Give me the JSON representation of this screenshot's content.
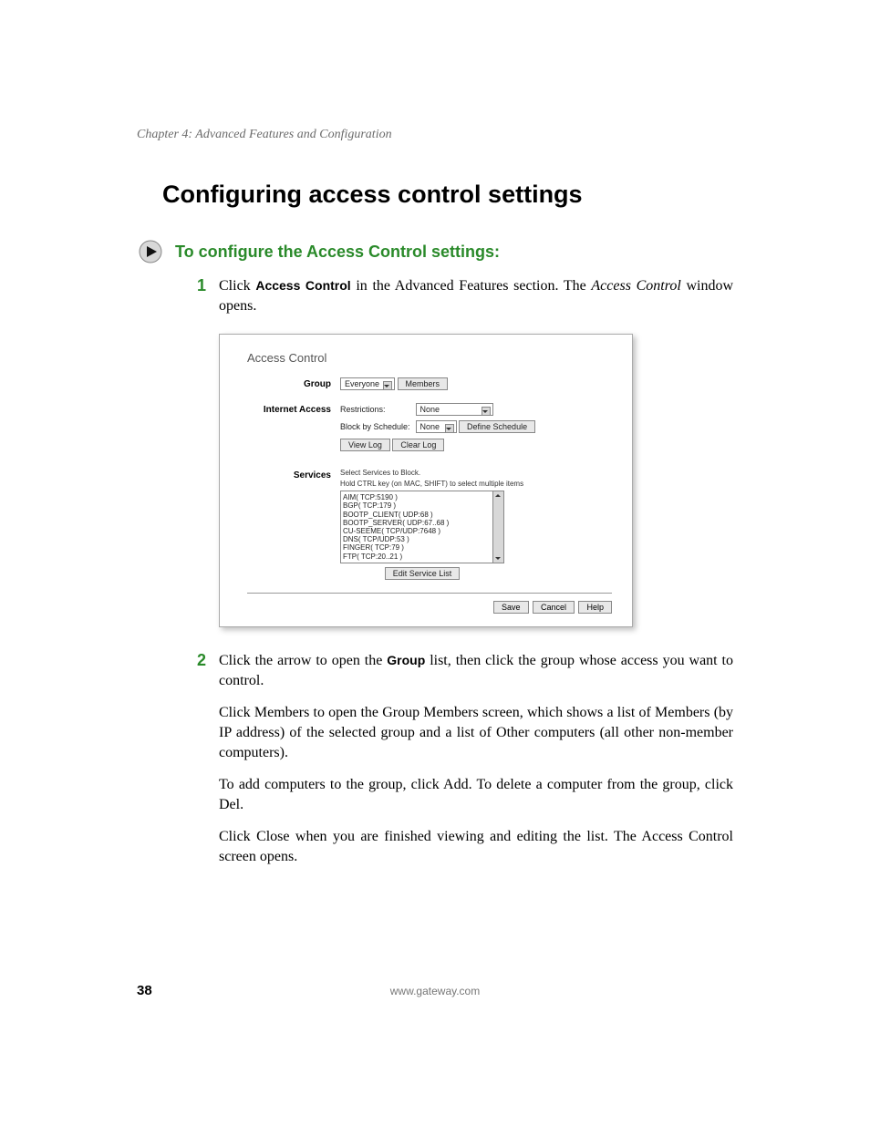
{
  "chapter": "Chapter 4: Advanced Features and Configuration",
  "h1": "Configuring access control settings",
  "task_title": "To configure the Access Control settings:",
  "steps": {
    "s1": {
      "num": "1",
      "pre": "Click ",
      "bold": "Access Control",
      "mid": " in the Advanced Features section. The ",
      "ital": "Access Control",
      "post": " window opens."
    },
    "s2": {
      "num": "2",
      "pre": "Click the arrow to open the ",
      "bold": "Group",
      "post": " list, then click the group whose access you want to control."
    }
  },
  "shot": {
    "title": "Access Control",
    "group_label": "Group",
    "group_select": "Everyone",
    "members_btn": "Members",
    "ia_label": "Internet Access",
    "restrictions_label": "Restrictions:",
    "restrictions_select": "None",
    "block_label": "Block by Schedule:",
    "block_select": "None",
    "define_btn": "Define Schedule",
    "view_log_btn": "View Log",
    "clear_log_btn": "Clear Log",
    "services_label": "Services",
    "services_hint1": "Select Services to Block.",
    "services_hint2": "Hold CTRL key (on MAC, SHIFT) to select multiple items",
    "services_list": [
      "AIM( TCP:5190 )",
      "BGP( TCP:179 )",
      "BOOTP_CLIENT( UDP:68 )",
      "BOOTP_SERVER( UDP:67..68 )",
      "CU-SEEME( TCP/UDP:7648 )",
      "DNS( TCP/UDP:53 )",
      "FINGER( TCP:79 )",
      "FTP( TCP:20..21 )"
    ],
    "edit_btn": "Edit Service List",
    "save_btn": "Save",
    "cancel_btn": "Cancel",
    "help_btn": "Help"
  },
  "paras": {
    "p1": {
      "pre": "Click ",
      "b1": "Members",
      "mid1": " to open the ",
      "i1": "Group Members",
      "post": " screen, which shows a list of Members (by IP address) of the selected group and a list of Other computers (all other non-member computers)."
    },
    "p2": {
      "pre": "To add computers to the group, click ",
      "b1": "Add",
      "mid": ". To delete a computer from the group, click ",
      "b2": "Del",
      "post": "."
    },
    "p3": {
      "pre": "Click ",
      "b1": "Close",
      "mid": " when you are finished viewing and editing the list. The ",
      "i1": "Access Control",
      "post": " screen opens."
    }
  },
  "footer": {
    "page": "38",
    "url": "www.gateway.com"
  }
}
